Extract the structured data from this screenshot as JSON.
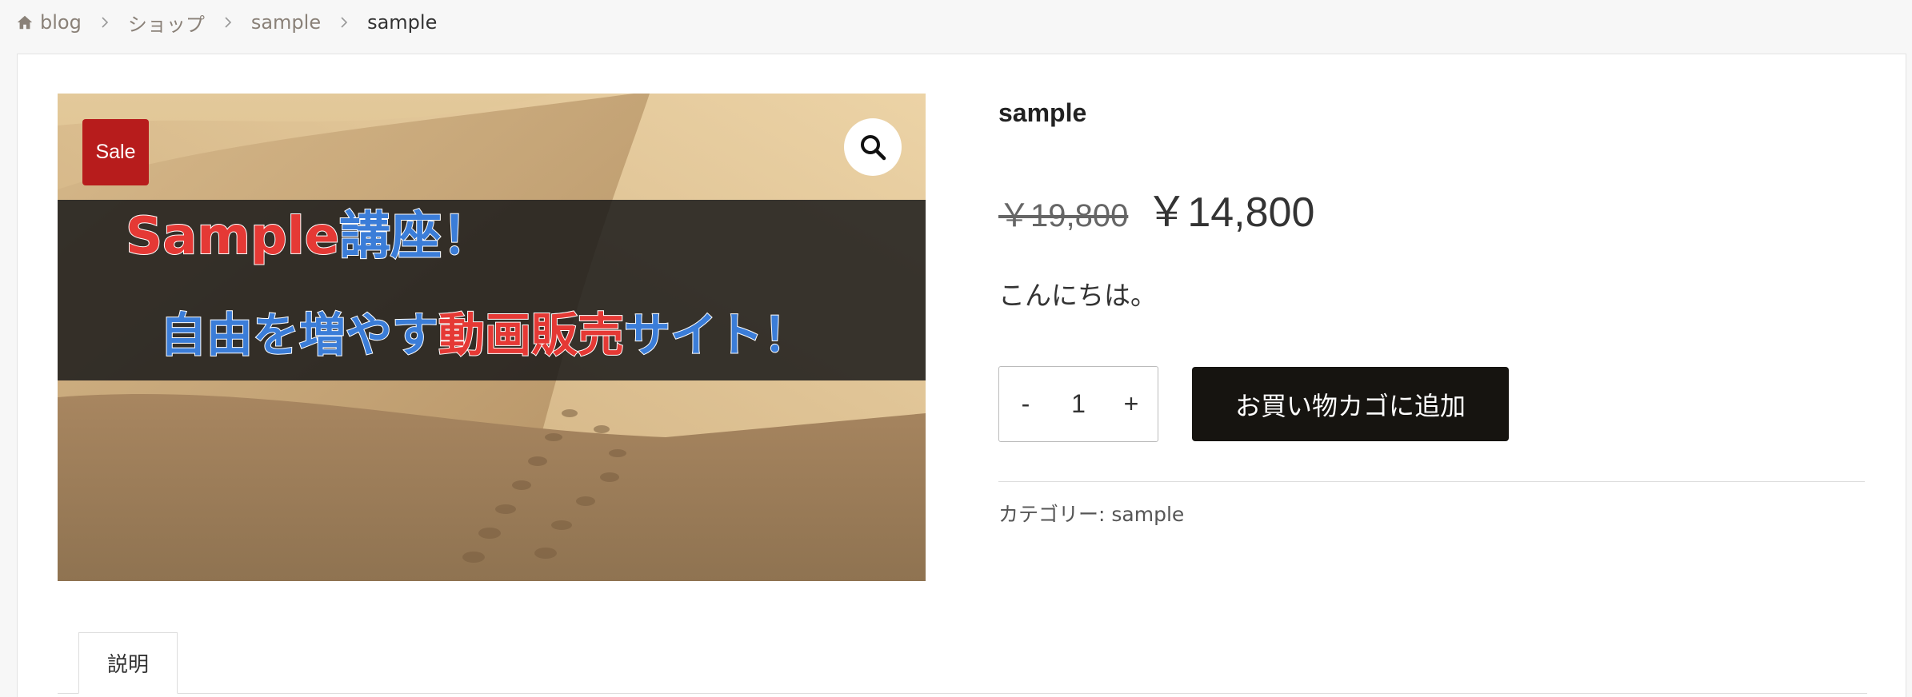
{
  "breadcrumb": {
    "items": [
      {
        "label": "blog"
      },
      {
        "label": "ショップ"
      },
      {
        "label": "sample"
      },
      {
        "label": "sample"
      }
    ]
  },
  "product": {
    "title": "sample",
    "sale_badge": "Sale",
    "price_regular": "￥19,800",
    "price_sale": "￥14,800",
    "short_description": "こんにちは。",
    "quantity": "1",
    "qty_minus": "-",
    "qty_plus": "+",
    "add_to_cart_label": "お買い物カゴに追加",
    "category_label": "カテゴリー:",
    "category_value": "sample",
    "image_text": {
      "line1_part1": "Sample",
      "line1_part2": "講座！",
      "line2_part1": "自由を増やす",
      "line2_part2": "動画販売",
      "line2_part3": "サイト！"
    }
  },
  "tabs": [
    {
      "label": "説明"
    }
  ],
  "colors": {
    "sale_badge": "#b71c1c",
    "cart_button": "#161410",
    "banner_red": "#e53935",
    "banner_blue": "#3b7dd8"
  },
  "icons": {
    "home": "home-icon",
    "separator": "chevron-right-icon",
    "zoom": "search-icon"
  }
}
